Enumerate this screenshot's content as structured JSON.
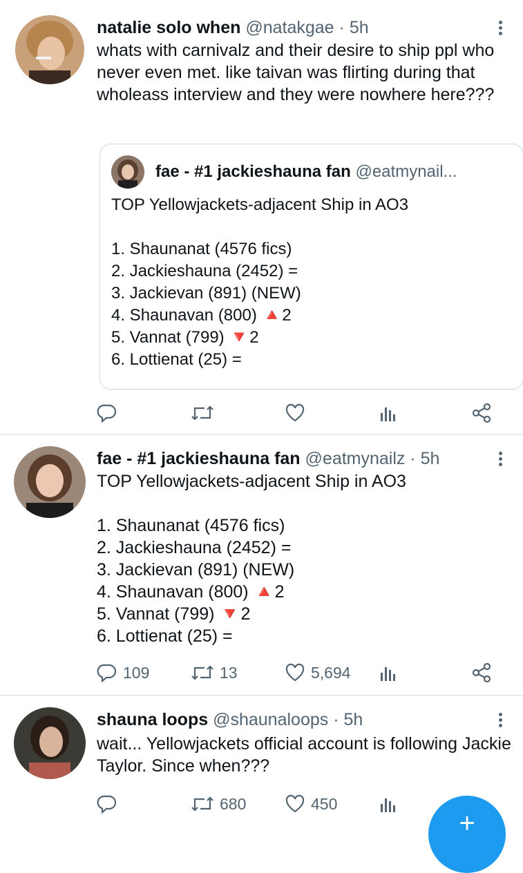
{
  "tweets": [
    {
      "name": "natalie solo when",
      "handle": "@natakgae",
      "sep": "·",
      "time": "5h",
      "text": "whats with carnivalz and their desire to ship ppl who never even met. like taivan was flirting during that wholeass interview and they were nowhere here???",
      "quote": {
        "name": "fae - #1 jackieshauna fan",
        "handle": "@eatmynail...",
        "text": "TOP Yellowjackets-adjacent Ship in AO3\n\n1. Shaunanat (4576 fics)\n2. Jackieshauna (2452) =\n3. Jackievan (891) (NEW)\n4. Shaunavan (800) 🔺2\n5. Vannat (799) 🔻2\n6. Lottienat (25)  ="
      },
      "counts": {
        "reply": "",
        "retweet": "",
        "like": ""
      }
    },
    {
      "name": "fae - #1 jackieshauna fan",
      "handle": "@eatmynailz",
      "sep": "·",
      "time": "5h",
      "text": "TOP Yellowjackets-adjacent Ship in AO3\n\n1. Shaunanat (4576 fics)\n2. Jackieshauna (2452) =\n3. Jackievan (891) (NEW)\n4. Shaunavan (800) 🔺2\n5. Vannat (799) 🔻2\n6. Lottienat (25)  =",
      "counts": {
        "reply": "109",
        "retweet": "13",
        "like": "5,694"
      }
    },
    {
      "name": "shauna loops",
      "handle": "@shaunaloops",
      "sep": "·",
      "time": "5h",
      "text": "wait... Yellowjackets official account is following Jackie Taylor. Since when???",
      "counts": {
        "reply": "",
        "retweet": "680",
        "like": "450"
      }
    }
  ],
  "icons": {
    "reply": "reply-icon",
    "retweet": "retweet-icon",
    "like": "heart-icon",
    "views": "analytics-icon",
    "share": "share-icon",
    "more": "more-vertical-icon",
    "fab": "compose-plus-icon"
  },
  "fab": {
    "label": "+"
  },
  "colors": {
    "accent": "#1d9bf0",
    "muted": "#536471",
    "divider": "#e6ecf0"
  }
}
